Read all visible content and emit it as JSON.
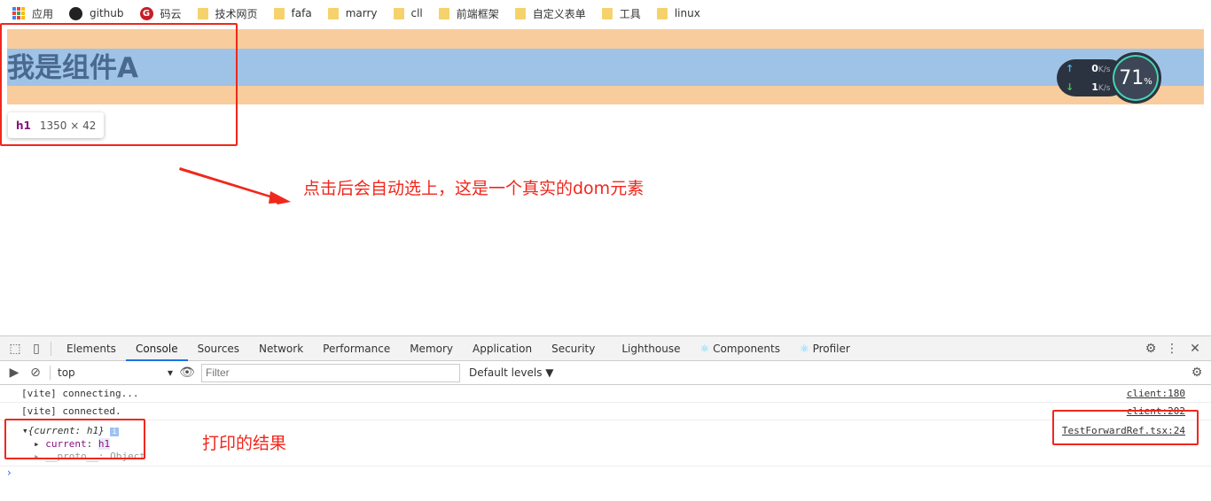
{
  "bookmarks": [
    {
      "label": "应用",
      "icon": "apps-icon"
    },
    {
      "label": "github",
      "icon": "github-icon"
    },
    {
      "label": "码云",
      "icon": "gitee-icon"
    },
    {
      "label": "技术网页",
      "icon": "folder-icon"
    },
    {
      "label": "fafa",
      "icon": "folder-icon"
    },
    {
      "label": "marry",
      "icon": "folder-icon"
    },
    {
      "label": "cll",
      "icon": "folder-icon"
    },
    {
      "label": "前端框架",
      "icon": "folder-icon"
    },
    {
      "label": "自定义表单",
      "icon": "folder-icon"
    },
    {
      "label": "工具",
      "icon": "folder-icon"
    },
    {
      "label": "linux",
      "icon": "folder-icon"
    }
  ],
  "page": {
    "heading": "我是组件A",
    "tooltip_tag": "h1",
    "tooltip_size": "1350 × 42",
    "annotation1": "点击后会自动选上，这是一个真实的dom元素",
    "annotation2": "打印的结果"
  },
  "netmon": {
    "up": "0",
    "down": "1",
    "unit": "K/s",
    "percent": "71",
    "pct_sign": "%"
  },
  "devtools": {
    "tabs": [
      "Elements",
      "Console",
      "Sources",
      "Network",
      "Performance",
      "Memory",
      "Application",
      "Security",
      "Lighthouse",
      "Components",
      "Profiler"
    ],
    "active_tab": "Console",
    "context": "top",
    "filter_placeholder": "Filter",
    "levels": "Default levels ▼",
    "logs": [
      {
        "text": "[vite] connecting...",
        "source": "client:180"
      },
      {
        "text": "[vite] connected.",
        "source": "client:202"
      }
    ],
    "object": {
      "summary": "{current: h1}",
      "prop_key": "current",
      "prop_val": "h1",
      "proto": "__proto__: Object",
      "source": "TestForwardRef.tsx:24"
    }
  },
  "colors": {
    "annotation": "#f0271c",
    "orange": "#f8cc9d",
    "blue": "#9fc3e7"
  }
}
